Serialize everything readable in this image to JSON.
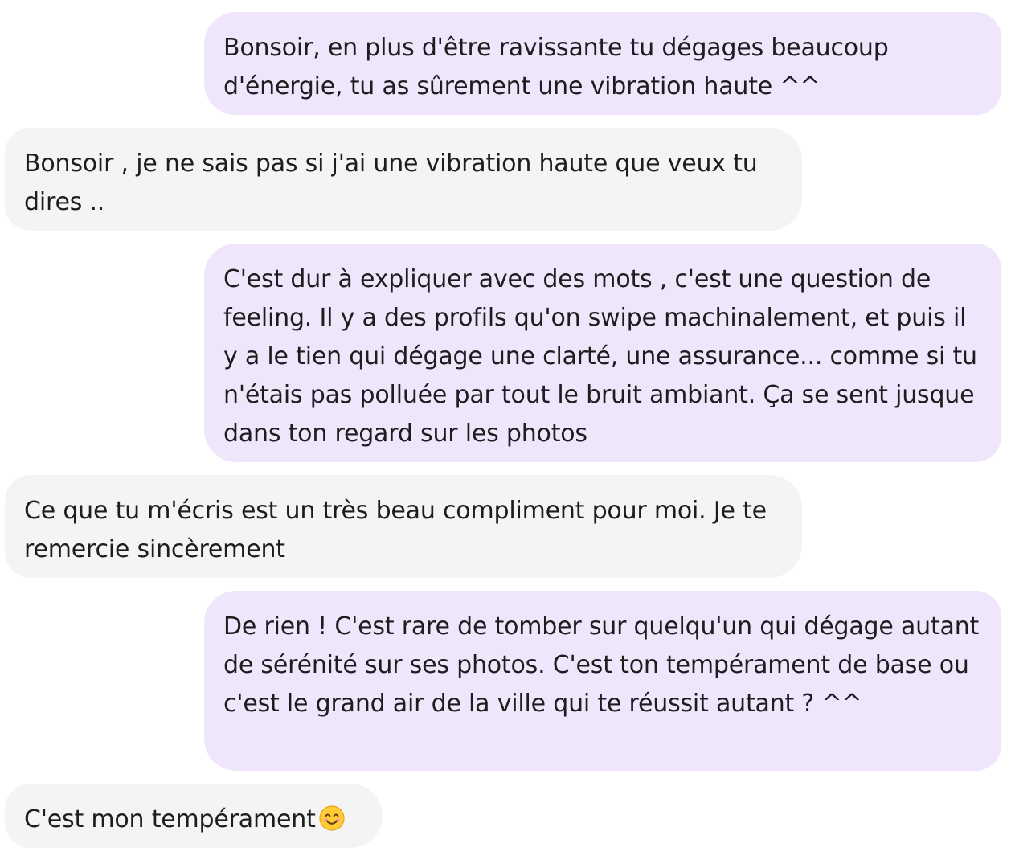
{
  "conversation": {
    "messages": [
      {
        "direction": "sent",
        "text": "Bonsoir, en plus d'être ravissante tu dégages beaucoup d'énergie, tu as sûrement une vibration haute ^^"
      },
      {
        "direction": "received",
        "text": "Bonsoir , je ne sais pas si j'ai une vibration haute que veux tu dires .."
      },
      {
        "direction": "sent",
        "text": "C'est dur à expliquer avec des mots , c'est une question de feeling. Il y a des profils qu'on swipe machinalement, et puis il y a le tien qui dégage une clarté, une assurance... comme si tu n'étais pas polluée par tout le bruit ambiant. Ça se sent jusque dans ton regard sur les photos"
      },
      {
        "direction": "received",
        "text": "Ce que tu m'écris est un très beau compliment pour moi. Je te remercie sincèrement"
      },
      {
        "direction": "sent",
        "text": "De rien ! C'est rare de tomber sur quelqu'un qui dégage autant de sérénité sur ses photos. C'est ton tempérament de base ou c'est le grand air de la ville qui te réussit autant ? ^^"
      },
      {
        "direction": "received",
        "text": "C'est mon tempérament",
        "trailing_icon": "smiling-face-emoji-icon"
      }
    ]
  },
  "colors": {
    "sent_bubble": "#efe6fb",
    "received_bubble": "#f4f4f4",
    "text": "#1d1d1f",
    "background": "#ffffff"
  }
}
